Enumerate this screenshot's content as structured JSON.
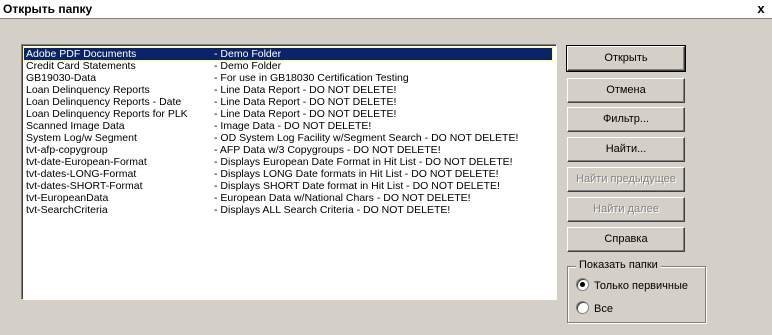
{
  "window": {
    "title": "Открыть папку",
    "close_label": "x"
  },
  "folders": [
    {
      "name": "Adobe PDF Documents",
      "desc": "- Demo Folder",
      "selected": true
    },
    {
      "name": "Credit Card Statements",
      "desc": "- Demo Folder"
    },
    {
      "name": "GB19030-Data",
      "desc": "- For use in GB18030 Certification Testing"
    },
    {
      "name": "Loan Delinquency Reports",
      "desc": "- Line Data Report - DO NOT DELETE!"
    },
    {
      "name": "Loan Delinquency Reports - Date",
      "desc": "- Line Data Report - DO NOT DELETE!"
    },
    {
      "name": "Loan Delinquency Reports for  PLK",
      "desc": "- Line Data Report - DO NOT DELETE!"
    },
    {
      "name": "Scanned Image Data",
      "desc": "- Image Data - DO NOT DELETE!"
    },
    {
      "name": "System Log/w Segment",
      "desc": "- OD System Log Facility w/Segment Search - DO NOT DELETE!"
    },
    {
      "name": "tvt-afp-copygroup",
      "desc": "- AFP Data w/3 Copygroups - DO NOT DELETE!"
    },
    {
      "name": "tvt-date-European-Format",
      "desc": "- Displays European Date Format in Hit List - DO NOT DELETE!"
    },
    {
      "name": "tvt-dates-LONG-Format",
      "desc": "- Displays LONG Date formats in Hit List - DO NOT DELETE!"
    },
    {
      "name": "tvt-dates-SHORT-Format",
      "desc": "- Displays SHORT Date format in Hit List - DO NOT DELETE!"
    },
    {
      "name": "tvt-EuropeanData",
      "desc": "- European Data w/National Chars - DO NOT DELETE!"
    },
    {
      "name": "tvt-SearchCriteria",
      "desc": "- Displays ALL Search Criteria - DO NOT DELETE!"
    }
  ],
  "buttons": {
    "open": "Открыть",
    "cancel": "Отмена",
    "filter": "Фильтр...",
    "find": "Найти...",
    "find_prev": "Найти предыдущее",
    "find_next": "Найти далее",
    "help": "Справка"
  },
  "show_folders": {
    "label": "Показать папки",
    "primary_only": "Только первичные",
    "all": "Все",
    "selected": "primary_only"
  }
}
